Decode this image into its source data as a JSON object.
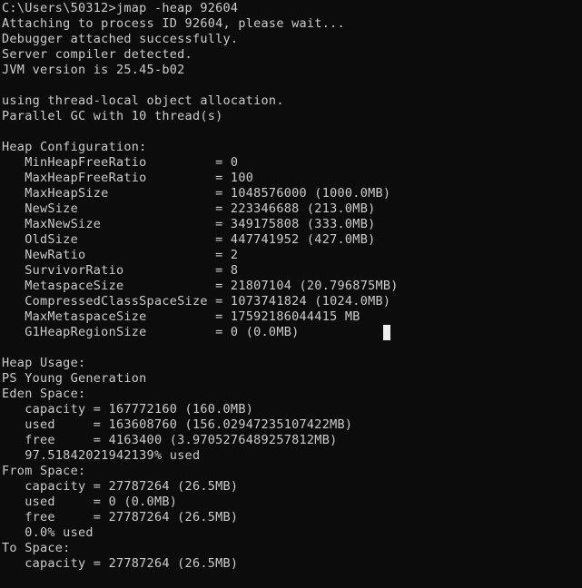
{
  "terminal": {
    "background_color": "#0c0c0c",
    "foreground_color": "#cccccc",
    "cursor_color": "#eeeeee",
    "prompt": "C:\\Users\\50312>",
    "command": "jmap -heap 92604",
    "cursor": {
      "row": 21,
      "col": 50,
      "visible": true
    }
  },
  "lines": [
    "C:\\Users\\50312>jmap -heap 92604",
    "Attaching to process ID 92604, please wait...",
    "Debugger attached successfully.",
    "Server compiler detected.",
    "JVM version is 25.45-b02",
    "",
    "using thread-local object allocation.",
    "Parallel GC with 10 thread(s)",
    "",
    "Heap Configuration:",
    "   MinHeapFreeRatio         = 0",
    "   MaxHeapFreeRatio         = 100",
    "   MaxHeapSize              = 1048576000 (1000.0MB)",
    "   NewSize                  = 223346688 (213.0MB)",
    "   MaxNewSize               = 349175808 (333.0MB)",
    "   OldSize                  = 447741952 (427.0MB)",
    "   NewRatio                 = 2",
    "   SurvivorRatio            = 8",
    "   MetaspaceSize            = 21807104 (20.796875MB)",
    "   CompressedClassSpaceSize = 1073741824 (1024.0MB)",
    "   MaxMetaspaceSize         = 17592186044415 MB",
    "   G1HeapRegionSize         = 0 (0.0MB)",
    "",
    "Heap Usage:",
    "PS Young Generation",
    "Eden Space:",
    "   capacity = 167772160 (160.0MB)",
    "   used     = 163608760 (156.02947235107422MB)",
    "   free     = 4163400 (3.9705276489257812MB)",
    "   97.51842021942139% used",
    "From Space:",
    "   capacity = 27787264 (26.5MB)",
    "   used     = 0 (0.0MB)",
    "   free     = 27787264 (26.5MB)",
    "   0.0% used",
    "To Space:",
    "   capacity = 27787264 (26.5MB)"
  ],
  "heap_configuration": {
    "MinHeapFreeRatio": "0",
    "MaxHeapFreeRatio": "100",
    "MaxHeapSize": "1048576000 (1000.0MB)",
    "NewSize": "223346688 (213.0MB)",
    "MaxNewSize": "349175808 (333.0MB)",
    "OldSize": "447741952 (427.0MB)",
    "NewRatio": "2",
    "SurvivorRatio": "8",
    "MetaspaceSize": "21807104 (20.796875MB)",
    "CompressedClassSpaceSize": "1073741824 (1024.0MB)",
    "MaxMetaspaceSize": "17592186044415 MB",
    "G1HeapRegionSize": "0 (0.0MB)"
  },
  "heap_usage": {
    "generation": "PS Young Generation",
    "eden_space": {
      "capacity": "167772160 (160.0MB)",
      "used": "163608760 (156.02947235107422MB)",
      "free": "4163400 (3.9705276489257812MB)",
      "percent_used": "97.51842021942139% used"
    },
    "from_space": {
      "capacity": "27787264 (26.5MB)",
      "used": "0 (0.0MB)",
      "free": "27787264 (26.5MB)",
      "percent_used": "0.0% used"
    },
    "to_space": {
      "capacity": "27787264 (26.5MB)"
    }
  }
}
